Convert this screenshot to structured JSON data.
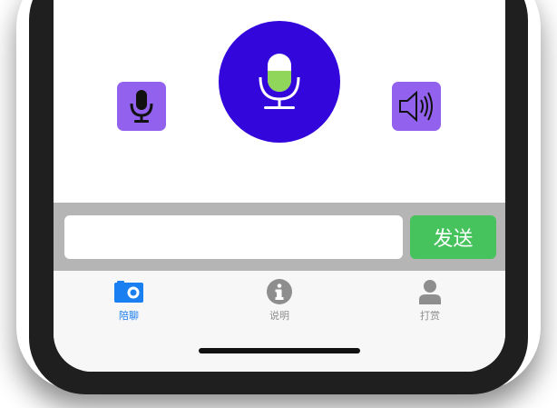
{
  "colors": {
    "voice_button_bg": "#9262ee",
    "main_mic_bg": "#3306db",
    "mic_level_fill": "#8fd65a",
    "send_button_bg": "#46c35d",
    "input_bar_bg": "#b5b5b5",
    "tab_active": "#1a7ff0",
    "tab_inactive": "#8e8e8e"
  },
  "voice_controls": {
    "left_button_icon": "microphone-icon",
    "main_button_icon": "microphone-level-icon",
    "mic_level": 0.55,
    "right_button_icon": "speaker-icon"
  },
  "input_bar": {
    "message_value": "",
    "message_placeholder": "",
    "send_label": "发送"
  },
  "tab_bar": {
    "tabs": [
      {
        "label": "陪聊",
        "icon": "camera-icon",
        "active": true
      },
      {
        "label": "说明",
        "icon": "info-icon",
        "active": false
      },
      {
        "label": "打赏",
        "icon": "person-icon",
        "active": false
      }
    ]
  }
}
